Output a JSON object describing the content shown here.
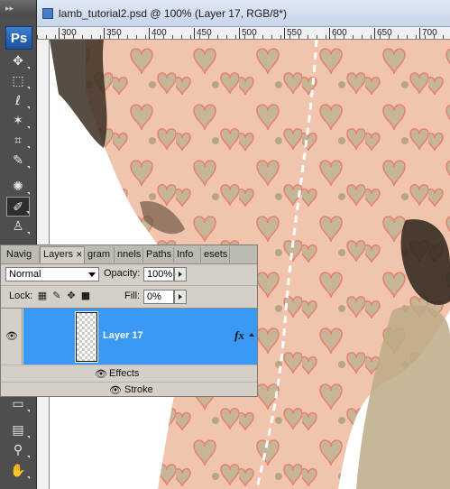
{
  "document": {
    "title": "lamb_tutorial2.psd @ 100% (Layer 17, RGB/8*)",
    "ruler_labels": [
      "300",
      "350",
      "400",
      "450",
      "500",
      "550",
      "600",
      "650",
      "700"
    ]
  },
  "toolbar": {
    "logo": "Ps",
    "tools": [
      {
        "name": "move-tool-icon",
        "glyph": "✥"
      },
      {
        "name": "marquee-tool-icon",
        "glyph": "⬚"
      },
      {
        "name": "lasso-tool-icon",
        "glyph": "ℓ"
      },
      {
        "name": "magic-wand-tool-icon",
        "glyph": "✶"
      },
      {
        "name": "crop-tool-icon",
        "glyph": "⌗"
      },
      {
        "name": "eyedropper-tool-icon",
        "glyph": "✎"
      },
      {
        "name": "healing-brush-tool-icon",
        "glyph": "✺"
      },
      {
        "name": "brush-tool-icon",
        "glyph": "✐"
      },
      {
        "name": "clone-stamp-tool-icon",
        "glyph": "♙"
      },
      {
        "name": "shape-tool-icon",
        "glyph": "▭"
      },
      {
        "name": "notes-tool-icon",
        "glyph": "▤"
      },
      {
        "name": "eyedropper2-tool-icon",
        "glyph": "⚲"
      },
      {
        "name": "hand-tool-icon",
        "glyph": "✋"
      }
    ]
  },
  "layers_panel": {
    "tabs": [
      {
        "label": "Navig",
        "active": false
      },
      {
        "label": "Layers",
        "active": true
      },
      {
        "label": "gram",
        "active": false
      },
      {
        "label": "nnels",
        "active": false
      },
      {
        "label": "Paths",
        "active": false
      },
      {
        "label": "Info",
        "active": false
      },
      {
        "label": "esets",
        "active": false
      }
    ],
    "blend_mode": "Normal",
    "opacity_label": "Opacity:",
    "opacity_value": "100%",
    "lock_label": "Lock:",
    "fill_label": "Fill:",
    "fill_value": "0%",
    "layer_name": "Layer 17",
    "fx_label": "fx",
    "effects_label": "Effects",
    "stroke_label": "Stroke"
  },
  "colors": {
    "selection": "#3a99f4",
    "toolbar_bg": "#4e4e4e",
    "panel_bg": "#d4d0c8",
    "heart_fill": "#f1c4ad",
    "heart_stroke": "#e8806e",
    "fabric": "#c6b596"
  }
}
